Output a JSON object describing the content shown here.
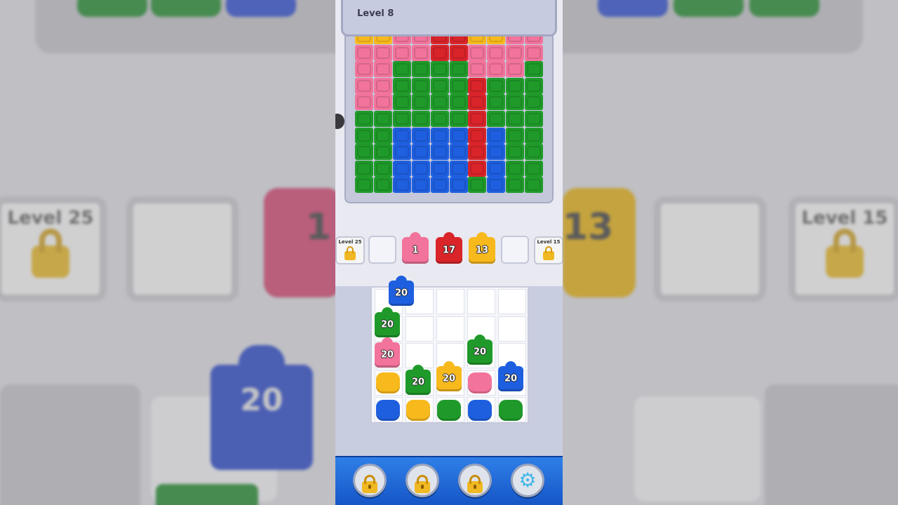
{
  "level_title": "Level 8",
  "colors": {
    "yellow": "#f7b91c",
    "pink": "#f2739b",
    "red": "#d92429",
    "green": "#1f9a2a",
    "blue": "#1e5fe0"
  },
  "board_rows": [
    [
      "yellow",
      "yellow",
      "pink",
      "pink",
      "red",
      "red",
      "yellow",
      "yellow",
      "pink",
      "pink"
    ],
    [
      "pink",
      "pink",
      "pink",
      "pink",
      "red",
      "red",
      "pink",
      "pink",
      "pink",
      "pink"
    ],
    [
      "pink",
      "pink",
      "green",
      "green",
      "green",
      "green",
      "pink",
      "pink",
      "pink",
      "green"
    ],
    [
      "pink",
      "pink",
      "green",
      "green",
      "green",
      "green",
      "red",
      "green",
      "green",
      "green"
    ],
    [
      "pink",
      "pink",
      "green",
      "green",
      "green",
      "green",
      "red",
      "green",
      "green",
      "green"
    ],
    [
      "green",
      "green",
      "green",
      "green",
      "green",
      "green",
      "red",
      "green",
      "green",
      "green"
    ],
    [
      "green",
      "green",
      "blue",
      "blue",
      "blue",
      "blue",
      "red",
      "blue",
      "green",
      "green"
    ],
    [
      "green",
      "green",
      "blue",
      "blue",
      "blue",
      "blue",
      "red",
      "blue",
      "green",
      "green"
    ],
    [
      "green",
      "green",
      "blue",
      "blue",
      "blue",
      "blue",
      "red",
      "blue",
      "green",
      "green"
    ],
    [
      "green",
      "green",
      "blue",
      "blue",
      "blue",
      "blue",
      "green",
      "blue",
      "green",
      "green"
    ]
  ],
  "tray": {
    "locked_left": {
      "label": "Level 25"
    },
    "locked_right": {
      "label": "Level 15"
    },
    "pieces": [
      {
        "color": "pink",
        "count": "1"
      },
      {
        "color": "red",
        "count": "17"
      },
      {
        "color": "yellow",
        "count": "13"
      }
    ]
  },
  "grid_pieces": [
    {
      "color": "blue",
      "count": "20"
    },
    {
      "color": "green",
      "count": "20"
    },
    {
      "color": "pink",
      "count": "20"
    },
    {
      "color": "green",
      "count": "20"
    },
    {
      "color": "green",
      "count": "20"
    },
    {
      "color": "yellow",
      "count": "20"
    },
    {
      "color": "blue",
      "count": "20"
    }
  ],
  "grid_blobs": [
    "yellow",
    "pink",
    "blue",
    "yellow",
    "green",
    "blue",
    "green"
  ],
  "bottom_buttons": [
    "lock-icon",
    "lock-icon",
    "lock-icon",
    "gear-icon"
  ],
  "background": {
    "left_label": "Level 25",
    "right_label": "Level 15",
    "left_number": "1",
    "right_number": "13",
    "big_number": "20"
  }
}
